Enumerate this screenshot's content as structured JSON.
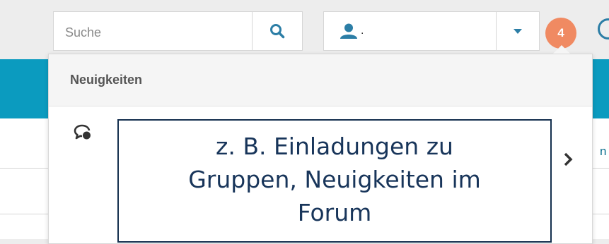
{
  "search": {
    "placeholder": "Suche"
  },
  "user": {
    "name": "."
  },
  "notifications": {
    "count": "4",
    "header": "Neuigkeiten"
  },
  "callout": {
    "lines": [
      "z. B. Einladungen zu",
      "Gruppen, Neuigkeiten im",
      "Forum"
    ]
  },
  "background": {
    "edge_text": "n"
  },
  "colors": {
    "accent_blue": "#2c7ea6",
    "teal_band": "#0b9bbf",
    "badge": "#f08a62",
    "callout_text": "#18355a"
  },
  "icons": [
    "search-icon",
    "user-icon",
    "caret-down-icon",
    "clock-icon",
    "chat-bubble-icon",
    "chevron-right-icon"
  ]
}
